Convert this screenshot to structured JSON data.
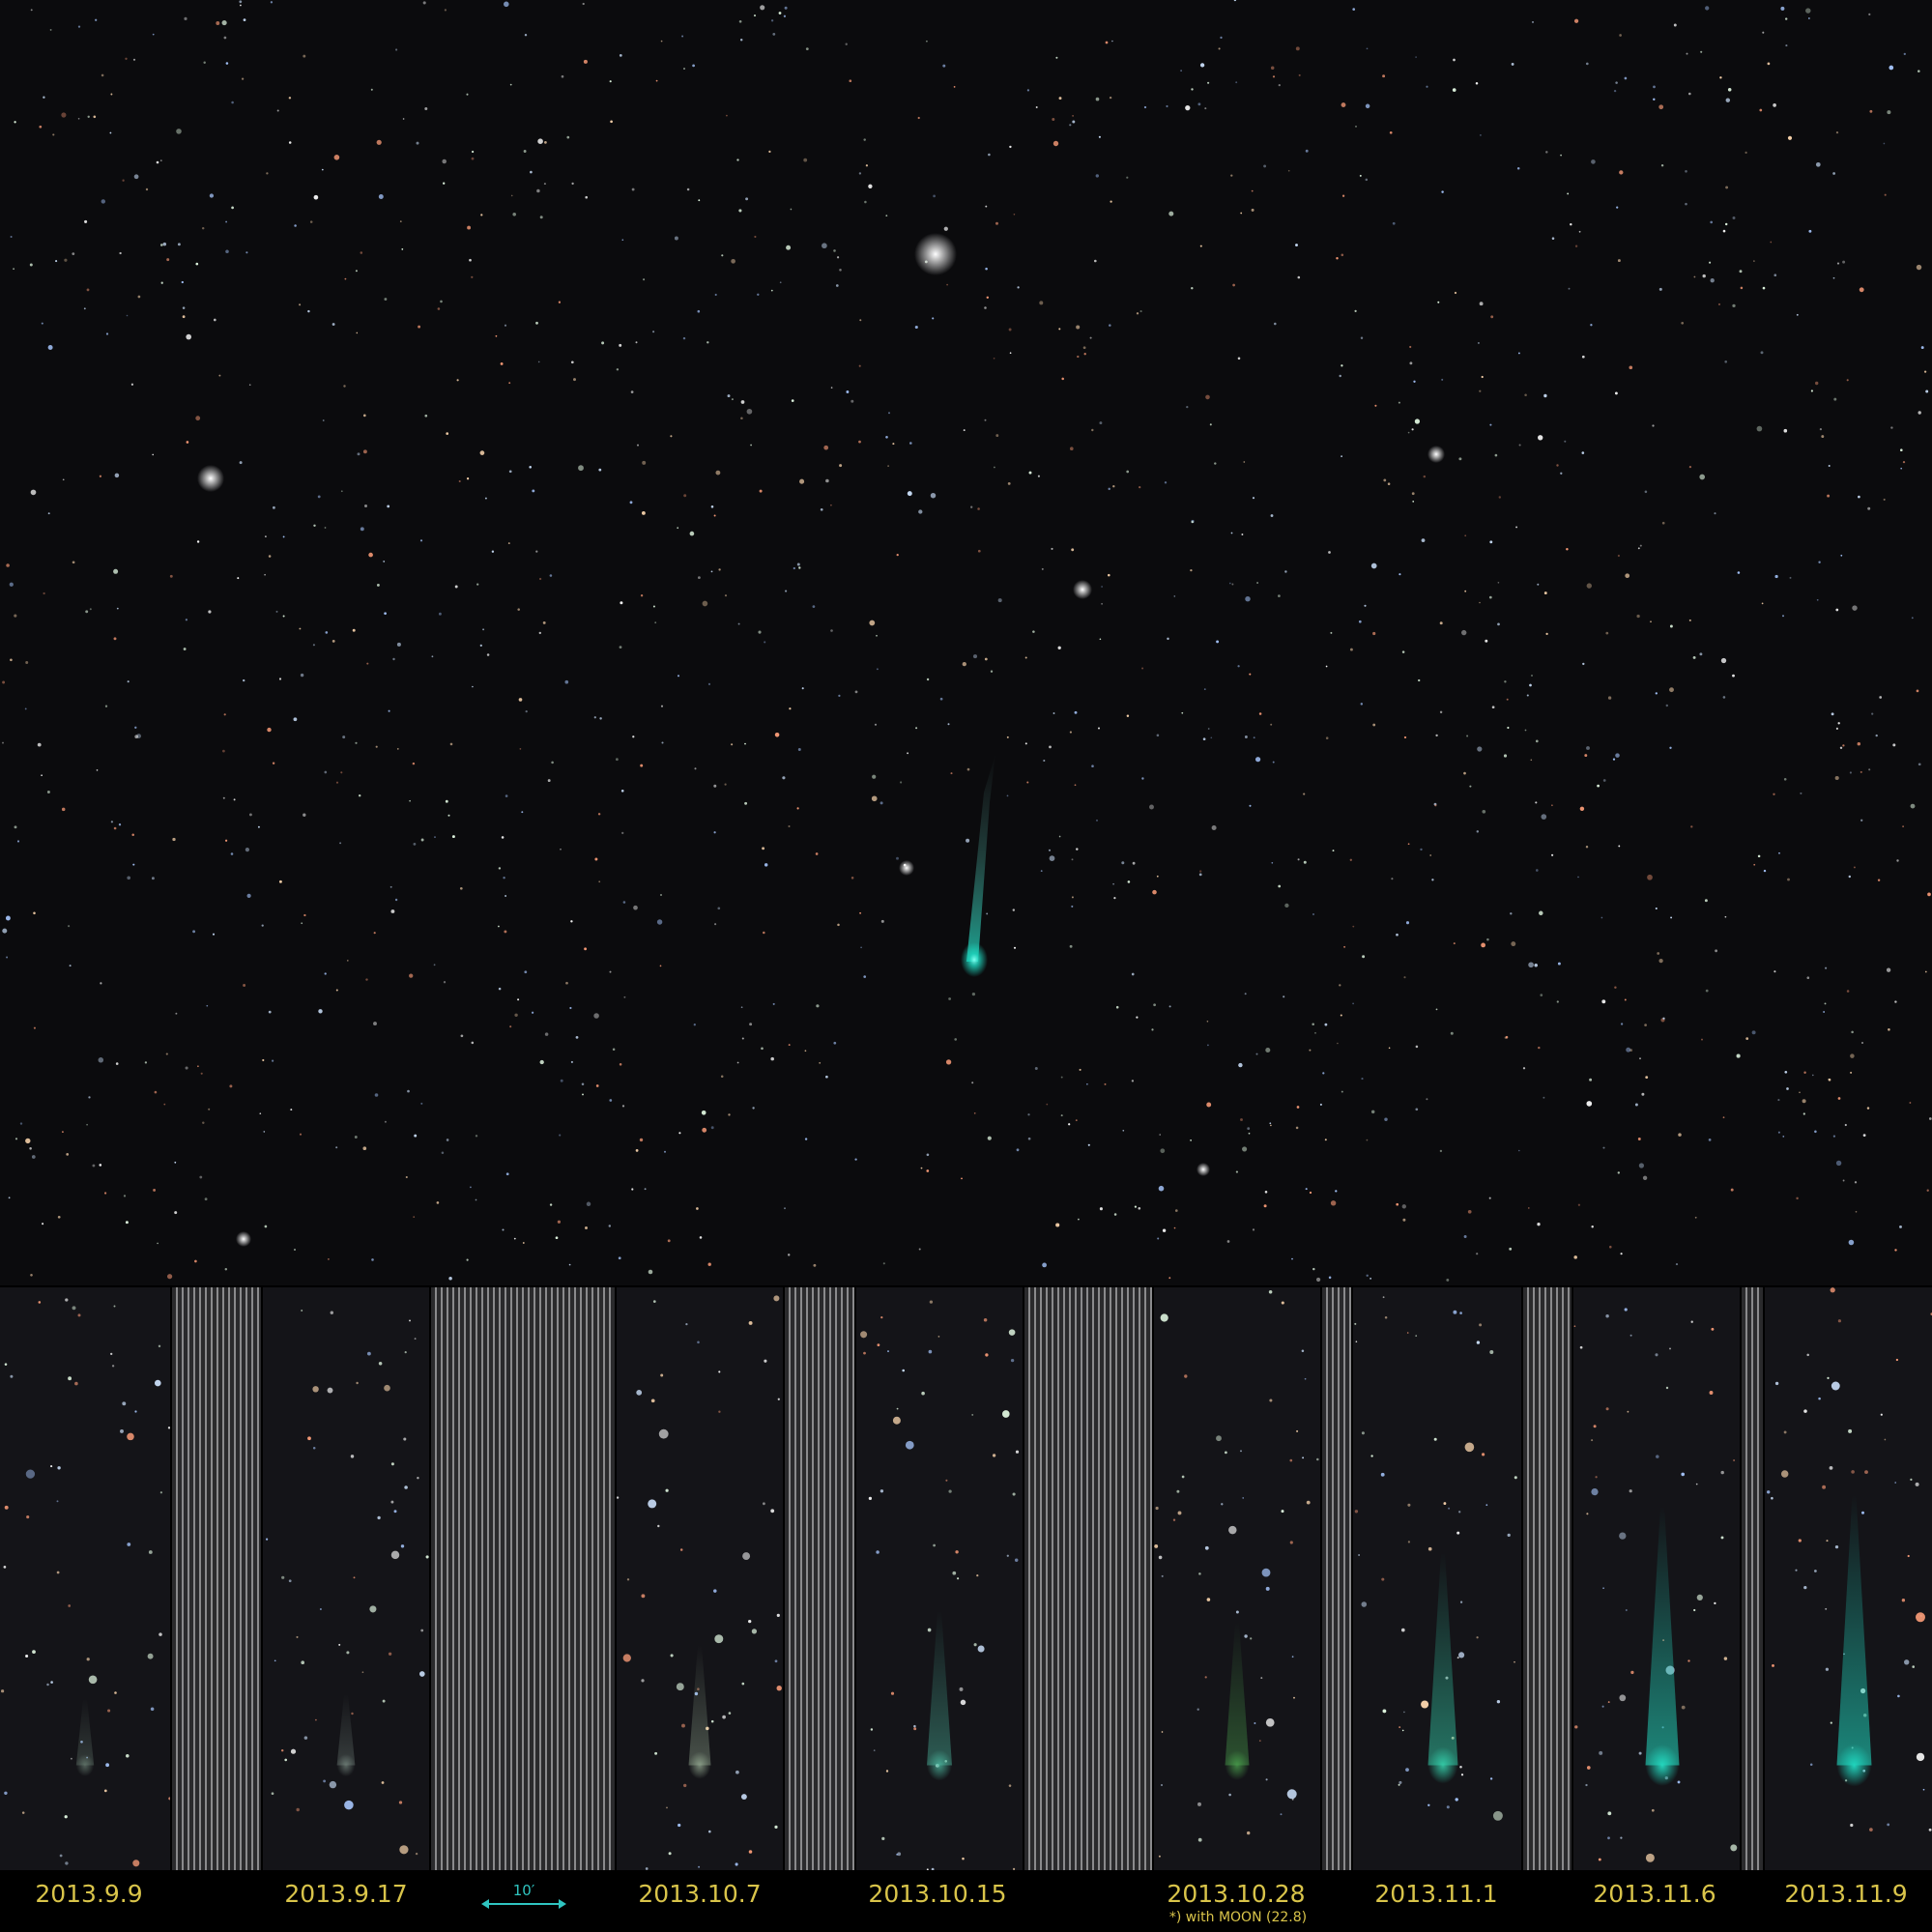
{
  "main_image": {
    "subject": "comet-in-star-field"
  },
  "sequence": {
    "panels": [
      {
        "date": "2013.9.9",
        "comet_color": "#7f9a8a",
        "comet_strength": 0.12
      },
      {
        "date": "2013.9.17",
        "comet_color": "#8fa49a",
        "comet_strength": 0.14
      },
      {
        "date": "2013.10.7",
        "comet_color": "#a6bea2",
        "comet_strength": 0.35
      },
      {
        "date": "2013.10.15",
        "comet_color": "#4fc0a6",
        "comet_strength": 0.5
      },
      {
        "date": "2013.10.28",
        "comet_color": "#4fae52",
        "comet_strength": 0.45,
        "note": "*) with MOON (22.8)"
      },
      {
        "date": "2013.11.1",
        "comet_color": "#35d2ad",
        "comet_strength": 0.75
      },
      {
        "date": "2013.11.6",
        "comet_color": "#24d9c0",
        "comet_strength": 0.95
      },
      {
        "date": "2013.11.9",
        "comet_color": "#20d4bd",
        "comet_strength": 1.0
      }
    ]
  },
  "scale_bar": {
    "label": "10′",
    "color": "#2fc4c0"
  },
  "colors": {
    "label_text": "#d9c44a",
    "comet_main": "#1fd8c0"
  }
}
